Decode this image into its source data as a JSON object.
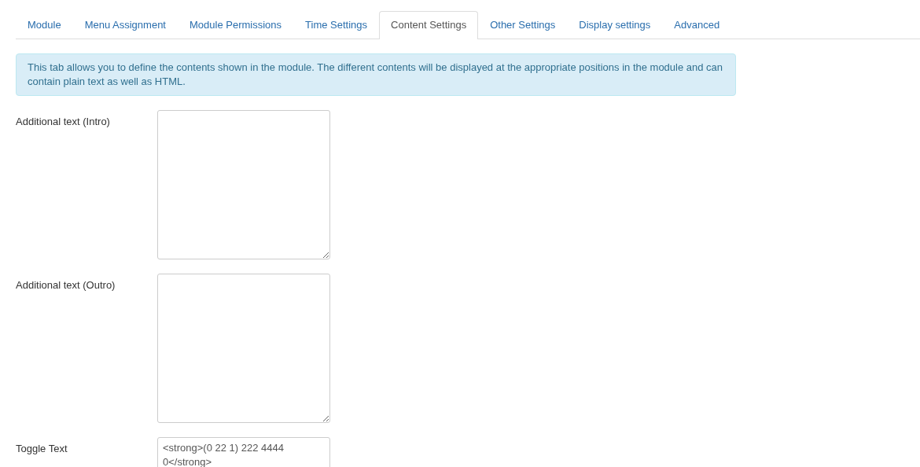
{
  "tabs": [
    {
      "label": "Module",
      "selected": false
    },
    {
      "label": "Menu Assignment",
      "selected": false
    },
    {
      "label": "Module Permissions",
      "selected": false
    },
    {
      "label": "Time Settings",
      "selected": false
    },
    {
      "label": "Content Settings",
      "selected": true
    },
    {
      "label": "Other Settings",
      "selected": false
    },
    {
      "label": "Display settings",
      "selected": false
    },
    {
      "label": "Advanced",
      "selected": false
    }
  ],
  "info_message": "This tab allows you to define the contents shown in the module. The different contents will be displayed at the appropriate positions in the module and can contain plain text as well as HTML.",
  "fields": [
    {
      "label": "Additional text (Intro)"
    },
    {
      "label": "Additional text (Outro)"
    },
    {
      "label": "Toggle Text",
      "value": "<strong>(0 22 1) 222 4444 0</strong>"
    }
  ]
}
